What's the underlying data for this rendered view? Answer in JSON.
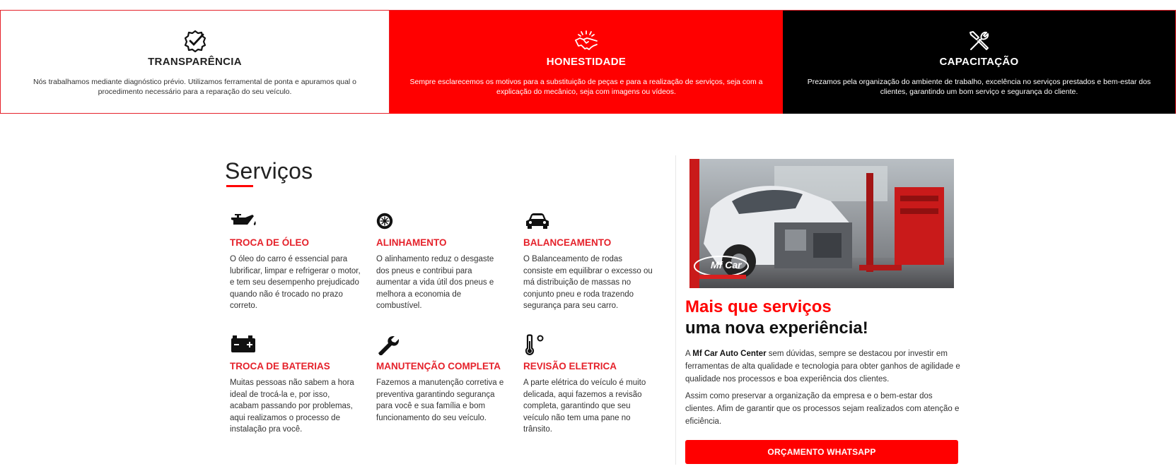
{
  "features": [
    {
      "title": "TRANSPARÊNCIA",
      "text": "Nós trabalhamos mediante diagnóstico prévio. Utilizamos ferramental de ponta e apuramos qual o procedimento necessário para a reparação do seu veículo.",
      "icon": "check-badge-icon"
    },
    {
      "title": "HONESTIDADE",
      "text": "Sempre esclarecemos os motivos para a substituição de peças e para a realização de serviços, seja com a explicação do mecânico, seja com imagens ou vídeos.",
      "icon": "handshake-icon"
    },
    {
      "title": "CAPACITAÇÃO",
      "text": "Prezamos pela organização do ambiente de trabalho, excelência no serviços prestados e bem-estar dos clientes, garantindo um bom serviço e segurança do cliente.",
      "icon": "tools-icon"
    }
  ],
  "services": {
    "title": "Serviços",
    "items": [
      {
        "title": "TROCA DE ÓLEO",
        "text": "O óleo do carro é essencial para lubrificar, limpar e refrigerar o motor, e tem seu desempenho prejudicado quando não é trocado no prazo correto.",
        "icon": "oil-can-icon"
      },
      {
        "title": "ALINHAMENTO",
        "text": "O alinhamento reduz o desgaste dos pneus e contribui para aumentar a vida útil dos pneus e melhora a economia de combustível.",
        "icon": "tire-icon"
      },
      {
        "title": "BALANCEAMENTO",
        "text": "O Balanceamento de rodas consiste em equilibrar o excesso ou má distribuição de massas no conjunto pneu e roda trazendo segurança para seu carro.",
        "icon": "car-icon"
      },
      {
        "title": "TROCA DE BATERIAS",
        "text": "Muitas pessoas não sabem a hora ideal de trocá-la e, por isso, acabam passando por problemas, aqui realizamos o processo de instalação pra você.",
        "icon": "battery-icon"
      },
      {
        "title": "MANUTENÇÃO COMPLETA",
        "text": "Fazemos a manutenção corretiva e preventiva garantindo segurança para você e sua família e bom funcionamento do seu veículo.",
        "icon": "wrench-icon"
      },
      {
        "title": "REVISÃO ELETRICA",
        "text": "A parte elétrica do veículo é muito delicada, aqui fazemos a revisão completa, garantindo que seu veículo não tem uma pane no trânsito.",
        "icon": "thermometer-icon"
      }
    ]
  },
  "aside": {
    "photo_logo": "Mf Car",
    "heading_red": "Mais que serviços",
    "heading_black": "uma nova experiência!",
    "p1_prefix": "A ",
    "p1_brand": "Mf Car Auto Center",
    "p1_rest": " sem dúvidas, sempre se destacou por investir em ferramentas de alta qualidade e tecnologia para obter ganhos de agilidade e qualidade nos processos e boa experiência dos clientes.",
    "p2": "Assim como preservar a organização da empresa e o bem-estar dos clientes. Afim de garantir que os processos sejam realizados com atenção e eficiência.",
    "cta_label": "ORÇAMENTO WHATSAPP"
  },
  "colors": {
    "accent": "#ff0000",
    "accent_text": "#e5222b",
    "dark": "#000000"
  }
}
